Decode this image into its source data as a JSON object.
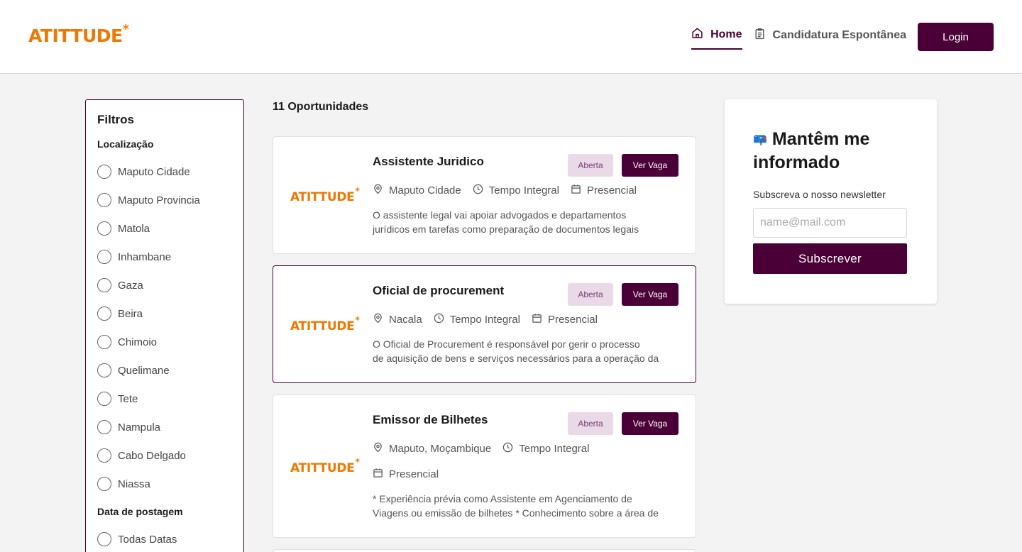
{
  "brand": {
    "logo_text": "ATITTUDE",
    "accent": "#f07800",
    "primary": "#4a0036"
  },
  "header": {
    "nav": [
      {
        "label": "Home",
        "icon": "home-icon",
        "active": true
      },
      {
        "label": "Candidatura Espontânea",
        "icon": "clipboard-icon",
        "active": false
      }
    ],
    "login_label": "Login"
  },
  "filters": {
    "title": "Filtros",
    "location_heading": "Localização",
    "locations": [
      "Maputo Cidade",
      "Maputo Provincia",
      "Matola",
      "Inhambane",
      "Gaza",
      "Beira",
      "Chimoio",
      "Quelimane",
      "Tete",
      "Nampula",
      "Cabo Delgado",
      "Niassa"
    ],
    "date_heading": "Data de postagem",
    "date_options": [
      "Todas Datas"
    ]
  },
  "listing": {
    "count_label": "11 Oportunidades",
    "jobs": [
      {
        "title": "Assistente Juridico",
        "status": "Aberta",
        "view_label": "Ver Vaga",
        "location": "Maputo Cidade",
        "schedule": "Tempo Integral",
        "mode": "Presencial",
        "desc_1": "O assistente legal vai apoiar advogados e departamentos",
        "desc_2": "jurídicos em tarefas como preparação de documentos legais"
      },
      {
        "title": "Oficial de procurement",
        "status": "Aberta",
        "view_label": "Ver Vaga",
        "location": "Nacala",
        "schedule": "Tempo Integral",
        "mode": "Presencial",
        "desc_1": "O Oficial de Procurement é responsável por gerir o processo",
        "desc_2": "de aquisição de bens e serviços necessários para a operação da"
      },
      {
        "title": "Emissor de Bilhetes",
        "status": "Aberta",
        "view_label": "Ver Vaga",
        "location": "Maputo, Moçambique",
        "schedule": "Tempo Integral",
        "mode": "Presencial",
        "desc_1": "* Experiência prévia como Assistente em Agenciamento de",
        "desc_2": "Viagens ou emissão de bilhetes * Conhecimento sobre a área de"
      }
    ]
  },
  "newsletter": {
    "emoji": "📪",
    "title": "Mantêm me informado",
    "subtitle": "Subscreva o nosso newsletter",
    "placeholder": "name@mail.com",
    "button_label": "Subscrever"
  }
}
